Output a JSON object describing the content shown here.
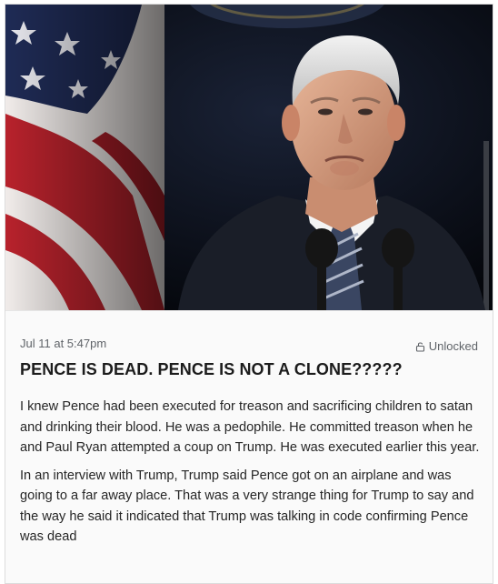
{
  "post": {
    "hero_image": {
      "subject": "man in dark suit with striped tie at microphones, American flag behind",
      "colors": {
        "background": "#06090f",
        "flag_red": "#b8222c",
        "flag_blue": "#1f2b55",
        "suit": "#1a1e28"
      }
    },
    "date": "Jul 11 at 5:47pm",
    "status": {
      "icon": "unlock-icon",
      "label": "Unlocked"
    },
    "title": "PENCE IS DEAD. PENCE IS NOT A CLONE?????",
    "paragraphs": [
      "I knew Pence had been executed for treason and sacrificing children to satan and drinking their blood. He was a pedophile. He committed treason when he and Paul Ryan attempted a coup on Trump. He was executed earlier this year.",
      "In an interview with Trump, Trump said Pence got on an airplane and was going to a far away place. That was a very strange thing for Trump to say and the way he said it indicated that Trump was talking in code confirming Pence was dead"
    ]
  }
}
